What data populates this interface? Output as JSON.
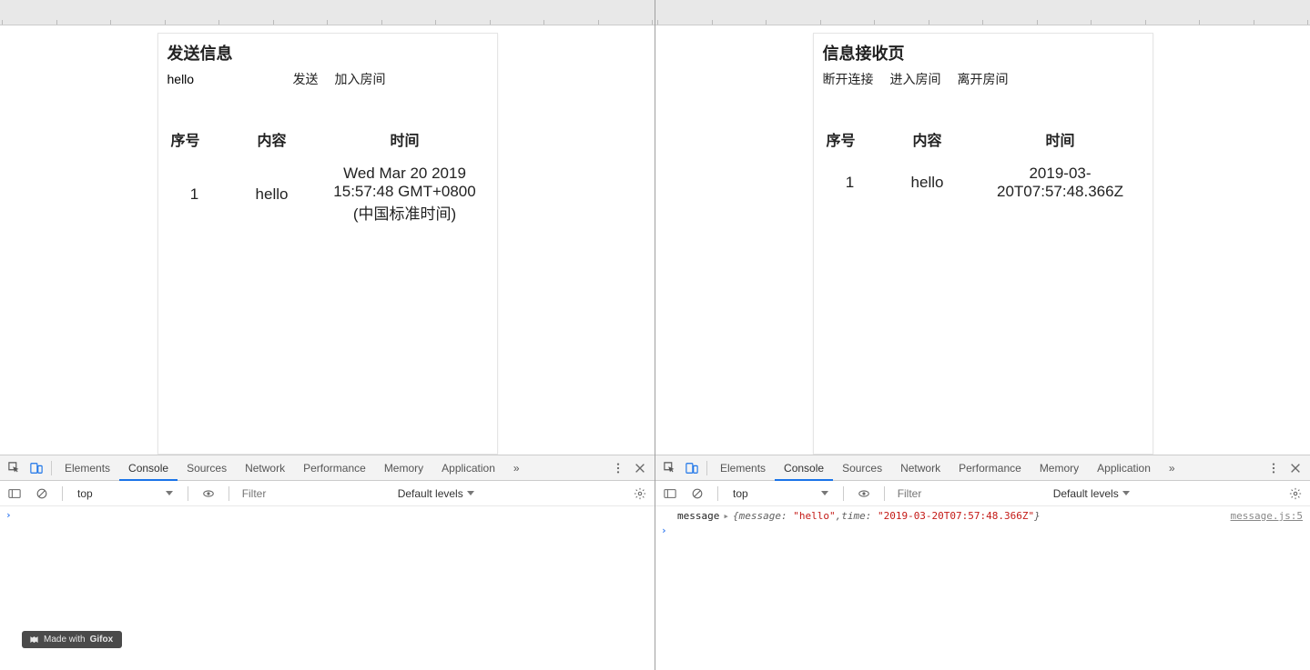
{
  "left": {
    "title": "发送信息",
    "input_value": "hello",
    "buttons": {
      "send": "发送",
      "join_room": "加入房间"
    },
    "table": {
      "headers": {
        "seq": "序号",
        "content": "内容",
        "time": "时间"
      },
      "rows": [
        {
          "seq": "1",
          "content": "hello",
          "time": "Wed Mar 20 2019 15:57:48 GMT+0800 (中国标准时间)"
        }
      ]
    }
  },
  "right": {
    "title": "信息接收页",
    "buttons": {
      "disconnect": "断开连接",
      "enter_room": "进入房间",
      "leave_room": "离开房间"
    },
    "table": {
      "headers": {
        "seq": "序号",
        "content": "内容",
        "time": "时间"
      },
      "rows": [
        {
          "seq": "1",
          "content": "hello",
          "time": "2019-03-20T07:57:48.366Z"
        }
      ]
    }
  },
  "devtools": {
    "tabs": [
      "Elements",
      "Console",
      "Sources",
      "Network",
      "Performance",
      "Memory",
      "Application"
    ],
    "active_tab": "Console",
    "context": "top",
    "filter_placeholder": "Filter",
    "levels": "Default levels",
    "overflow": "»"
  },
  "console_right": {
    "label": "message",
    "obj_prefix": "{",
    "k_message": "message:",
    "v_message": "\"hello\"",
    "comma": ", ",
    "k_time": "time:",
    "v_time": "\"2019-03-20T07:57:48.366Z\"",
    "obj_suffix": "}",
    "source": "message.js:5"
  },
  "watermark": {
    "prefix": "Made with ",
    "brand": "Gifox"
  }
}
